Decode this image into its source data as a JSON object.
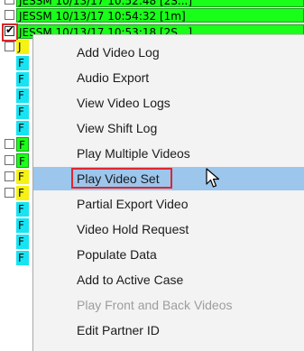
{
  "rows": [
    {
      "text": "JESSM 10/13/17 10:52:48 [2S...]",
      "color": "green",
      "checked": false
    },
    {
      "text": "JESSM 10/13/17 10:54:32 [1m]",
      "color": "green",
      "checked": false
    },
    {
      "text": "JESSM 10/13/17 10:53:18 [2S...]",
      "color": "green",
      "checked": true
    },
    {
      "text": "J",
      "color": "yellow",
      "checked": false
    },
    {
      "text": "F",
      "color": "cyan",
      "checked": false
    },
    {
      "text": "F",
      "color": "cyan",
      "checked": false
    },
    {
      "text": "F",
      "color": "cyan",
      "checked": false
    },
    {
      "text": "F",
      "color": "cyan",
      "checked": false
    },
    {
      "text": "F",
      "color": "cyan",
      "checked": false
    },
    {
      "text": "F",
      "color": "green",
      "checked": true
    },
    {
      "text": "F",
      "color": "green",
      "checked": true
    },
    {
      "text": "F",
      "color": "yellow",
      "checked": true
    },
    {
      "text": "F",
      "color": "yellow",
      "checked": true
    },
    {
      "text": "F",
      "color": "cyan",
      "checked": false
    },
    {
      "text": "F",
      "color": "cyan",
      "checked": false
    },
    {
      "text": "F",
      "color": "cyan",
      "checked": false
    },
    {
      "text": "F",
      "color": "cyan",
      "checked": false
    }
  ],
  "menu": {
    "items": [
      {
        "label": "Add Video Log",
        "enabled": true
      },
      {
        "label": "Audio Export",
        "enabled": true
      },
      {
        "label": "View Video Logs",
        "enabled": true
      },
      {
        "label": "View Shift Log",
        "enabled": true
      },
      {
        "label": "Play Multiple Videos",
        "enabled": true
      },
      {
        "label": "Play Video Set",
        "enabled": true,
        "hover": true
      },
      {
        "label": "Partial Export Video",
        "enabled": true
      },
      {
        "label": "Video Hold Request",
        "enabled": true
      },
      {
        "label": "Populate Data",
        "enabled": true
      },
      {
        "label": "Add to Active Case",
        "enabled": true
      },
      {
        "label": "Play Front and Back Videos",
        "enabled": false
      },
      {
        "label": "Edit Partner ID",
        "enabled": true
      }
    ]
  },
  "colors": {
    "green": "#1aff1a",
    "cyan": "#17e3f2",
    "yellow": "#f5f214",
    "hover": "#9cc6ec",
    "highlight": "#e0262e"
  },
  "cursor_icon": "arrow-pointer-icon"
}
